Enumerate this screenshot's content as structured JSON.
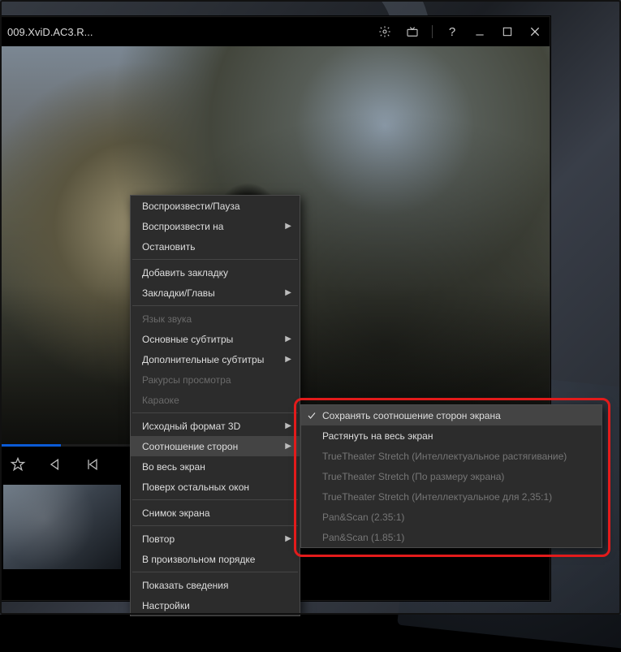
{
  "window": {
    "title": "009.XviD.AC3.R..."
  },
  "titlebar_icons": {
    "gear": "gear-icon",
    "tv": "tv-icon",
    "help": "?",
    "minimize": "minimize",
    "maximize": "maximize",
    "close": "close"
  },
  "context_menu": {
    "items": [
      {
        "label": "Воспроизвести/Пауза",
        "submenu": false,
        "disabled": false
      },
      {
        "label": "Воспроизвести на",
        "submenu": true,
        "disabled": false
      },
      {
        "label": "Остановить",
        "submenu": false,
        "disabled": false
      },
      {
        "label": "Добавить закладку",
        "submenu": false,
        "disabled": false
      },
      {
        "label": "Закладки/Главы",
        "submenu": true,
        "disabled": false
      },
      {
        "label": "Язык звука",
        "submenu": false,
        "disabled": true
      },
      {
        "label": "Основные субтитры",
        "submenu": true,
        "disabled": false
      },
      {
        "label": "Дополнительные субтитры",
        "submenu": true,
        "disabled": false
      },
      {
        "label": "Ракурсы просмотра",
        "submenu": false,
        "disabled": true
      },
      {
        "label": "Караоке",
        "submenu": false,
        "disabled": true
      },
      {
        "label": "Исходный формат 3D",
        "submenu": true,
        "disabled": false
      },
      {
        "label": "Соотношение сторон",
        "submenu": true,
        "disabled": false,
        "highlight": true
      },
      {
        "label": "Во весь экран",
        "submenu": false,
        "disabled": false
      },
      {
        "label": "Поверх остальных окон",
        "submenu": false,
        "disabled": false
      },
      {
        "label": "Снимок экрана",
        "submenu": false,
        "disabled": false
      },
      {
        "label": "Повтор",
        "submenu": true,
        "disabled": false
      },
      {
        "label": "В произвольном порядке",
        "submenu": false,
        "disabled": false
      },
      {
        "label": "Показать сведения",
        "submenu": false,
        "disabled": false
      },
      {
        "label": "Настройки",
        "submenu": false,
        "disabled": false
      }
    ],
    "separators_after": [
      2,
      4,
      9,
      13,
      14,
      16
    ]
  },
  "submenu": {
    "items": [
      {
        "label": "Сохранять соотношение сторон экрана",
        "checked": true,
        "selected": true,
        "disabled": false
      },
      {
        "label": "Растянуть на весь экран",
        "checked": false,
        "selected": false,
        "disabled": false
      },
      {
        "label": "TrueTheater Stretch (Интеллектуальное растягивание)",
        "checked": false,
        "selected": false,
        "disabled": true
      },
      {
        "label": "TrueTheater Stretch (По размеру экрана)",
        "checked": false,
        "selected": false,
        "disabled": true
      },
      {
        "label": "TrueTheater Stretch (Интеллектуальное для 2,35:1)",
        "checked": false,
        "selected": false,
        "disabled": true
      },
      {
        "label": "Pan&Scan (2.35:1)",
        "checked": false,
        "selected": false,
        "disabled": true
      },
      {
        "label": "Pan&Scan (1.85:1)",
        "checked": false,
        "selected": false,
        "disabled": true
      }
    ]
  },
  "controls": {
    "buttons": [
      "bookmark",
      "step-back",
      "prev"
    ]
  }
}
